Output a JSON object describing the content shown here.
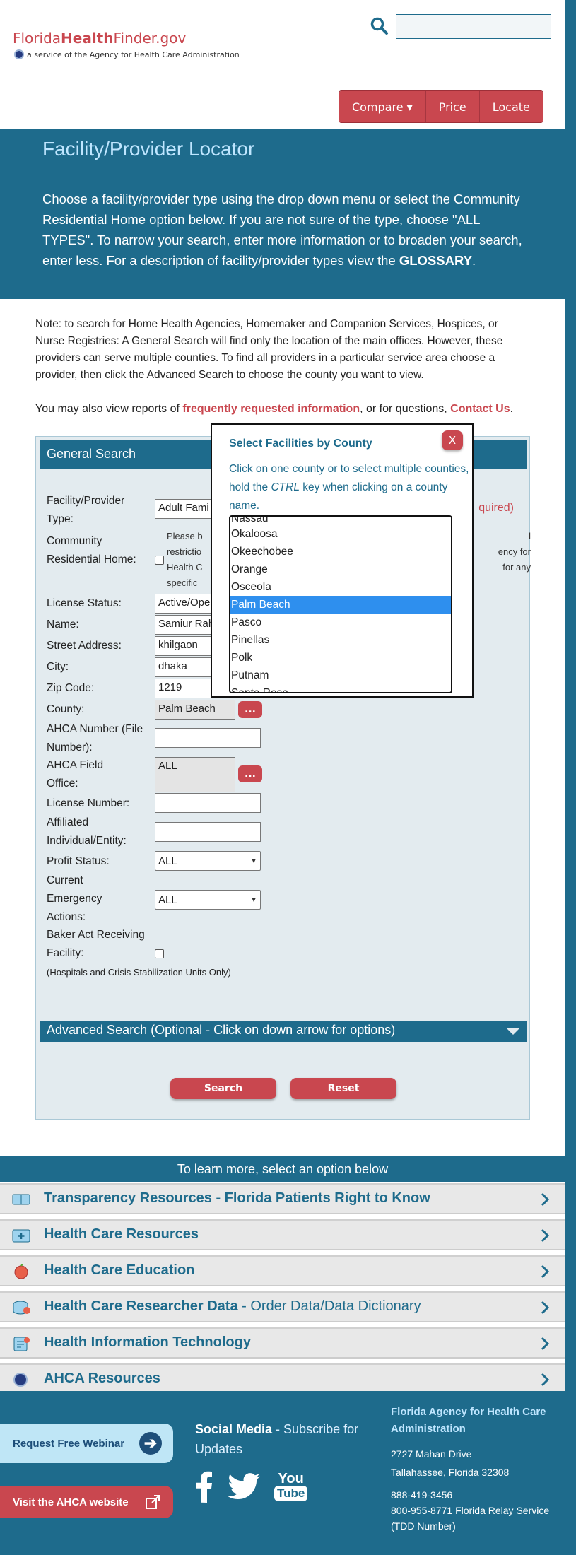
{
  "header": {
    "logo_plain1": "Florida",
    "logo_bold": "Health",
    "logo_plain2": "Finder.gov",
    "logo_sub": "a service of the Agency for Health Care Administration",
    "nav": [
      "Compare ▾",
      "Price",
      "Locate"
    ]
  },
  "hero": {
    "title": "Facility/Provider Locator",
    "text": "Choose a facility/provider type using the drop down menu or select the Community Residential Home option below. If you are not sure of the type, choose \"ALL TYPES\". To narrow your search, enter more information or to broaden your search, enter less. For a description of facility/provider types view the",
    "glossary": "GLOSSARY",
    "period": "."
  },
  "note": "Note: to search for Home Health Agencies, Homemaker and Companion Services, Hospices, or Nurse Registries: A General Search will find only the location of the main offices. However, these providers can serve multiple counties. To find all providers in a particular service area choose a provider, then click the Advanced Search to choose the county you want to view.",
  "also": {
    "pre": "You may also view reports of ",
    "link1": "frequently requested information",
    "mid": ", or for questions, ",
    "link2": "Contact Us",
    "end": "."
  },
  "form": {
    "heading": "General Search",
    "required": "quired)",
    "labels": {
      "type": "Facility/Provider Type:",
      "community": "Community Residential Home:",
      "license_status": "License Status:",
      "name": "Name:",
      "street": "Street Address:",
      "city": "City:",
      "zip": "Zip Code:",
      "county": "County:",
      "ahca_number": "AHCA Number (File Number):",
      "field_office": "AHCA Field Office:",
      "license_number": "License Number:",
      "affiliated": "Affiliated Individual/Entity:",
      "profit": "Profit Status:",
      "emergency": "Current Emergency Actions:",
      "baker": "Baker Act Receiving Facility:"
    },
    "values": {
      "type": "Adult Fami",
      "license_status": "Active/Ope",
      "name": "Samiur Rah",
      "street": "khilgaon",
      "city": "dhaka",
      "zip": "1219",
      "county": "Palm Beach",
      "field_office": "ALL",
      "profit": "ALL",
      "emergency": "ALL"
    },
    "community_note_left": "Please b\nrestrictio\nHealth C\nspecific",
    "community_note_right": "l\nency for\nfor any",
    "dots": "...",
    "baker_note": "(Hospitals and Crisis Stabilization Units Only)",
    "advanced": "Advanced Search (Optional - Click on down arrow for options)",
    "search_btn": "Search",
    "reset_btn": "Reset"
  },
  "modal": {
    "title": "Select Facilities by County",
    "close": "X",
    "text_pre": "Click on one county or to select multiple counties, hold the ",
    "text_key": "CTRL",
    "text_post": " key when clicking on a county name.",
    "counties": [
      "Nassau",
      "Okaloosa",
      "Okeechobee",
      "Orange",
      "Osceola",
      "Palm Beach",
      "Pasco",
      "Pinellas",
      "Polk",
      "Putnam",
      "Santa Rosa"
    ],
    "selected": "Palm Beach"
  },
  "resources": {
    "heading": "To learn more, select an option below",
    "items": [
      {
        "bold": "Transparency Resources - Florida Patients Right to Know",
        "rest": ""
      },
      {
        "bold": "Health Care Resources",
        "rest": ""
      },
      {
        "bold": "Health Care Education",
        "rest": ""
      },
      {
        "bold": "Health Care Researcher Data",
        "rest": " - Order Data/Data Dictionary"
      },
      {
        "bold": "Health Information Technology",
        "rest": ""
      },
      {
        "bold": "AHCA Resources",
        "rest": ""
      }
    ]
  },
  "footer": {
    "webinar": "Request Free Webinar",
    "ahca_site": "Visit the AHCA website",
    "social_bold": "Social Media",
    "social_rest": " - Subscribe for Updates",
    "org": "Florida Agency for Health Care Administration",
    "addr1": "2727 Mahan Drive",
    "addr2": "Tallahassee, Florida 32308",
    "phone1": "888-419-3456",
    "phone2": "800-955-8771 Florida Relay Service (TDD Number)"
  },
  "colors": {
    "brand_blue": "#1e6b8c",
    "accent_red": "#c9474f",
    "selection_blue": "#2e8fee"
  }
}
